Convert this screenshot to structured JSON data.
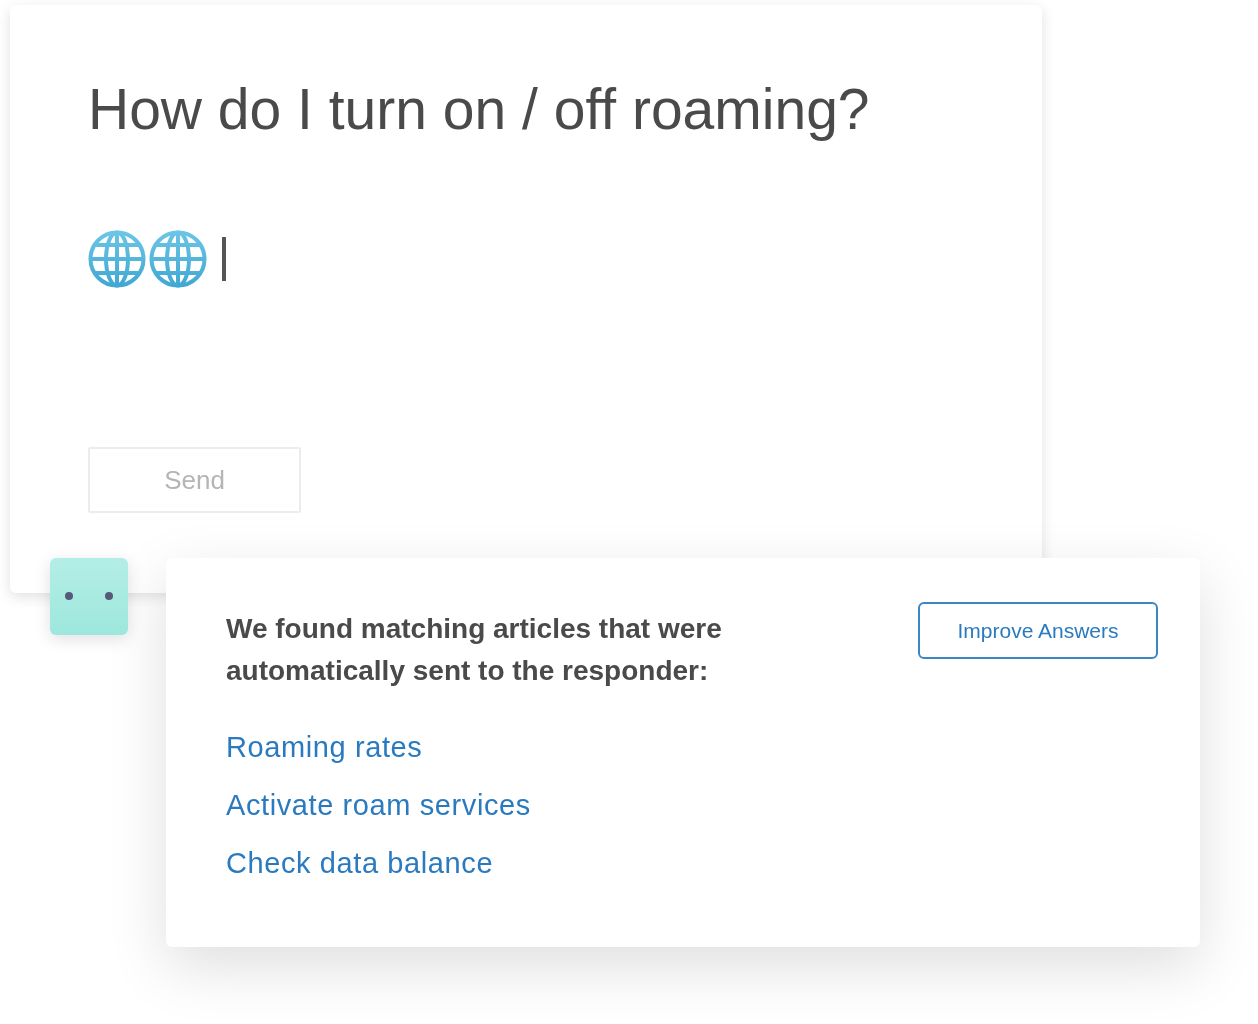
{
  "question_card": {
    "title": "How do I turn on / off roaming?",
    "message_field": {
      "emojis": [
        {
          "kind": "globe"
        },
        {
          "kind": "globe"
        }
      ],
      "focused": true
    },
    "send_button": {
      "label": "Send",
      "disabled": true
    }
  },
  "answer_card": {
    "message": "We found matching articles that were automatically sent to the responder:",
    "improve_button": {
      "label": "Improve Answers"
    },
    "articles": [
      {
        "title": "Roaming rates"
      },
      {
        "title": "Activate roam services"
      },
      {
        "title": "Check data balance"
      }
    ]
  }
}
